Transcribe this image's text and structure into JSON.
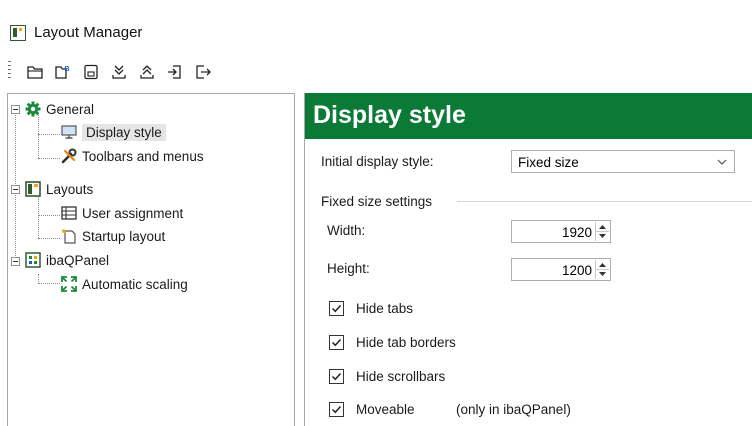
{
  "window": {
    "title": "Layout Manager"
  },
  "toolbar": {
    "buttons": [
      {
        "icon": "folder-open-icon"
      },
      {
        "icon": "folder-blue-icon"
      },
      {
        "icon": "save-icon"
      },
      {
        "icon": "import-icon"
      },
      {
        "icon": "export-icon"
      },
      {
        "icon": "login-icon"
      },
      {
        "icon": "logout-icon"
      }
    ]
  },
  "tree": {
    "general": {
      "label": "General",
      "children": {
        "display_style": "Display style",
        "toolbars": "Toolbars and menus"
      }
    },
    "layouts": {
      "label": "Layouts",
      "children": {
        "user_assignment": "User assignment",
        "startup_layout": "Startup layout"
      }
    },
    "ibaqpanel": {
      "label": "ibaQPanel",
      "children": {
        "automatic_scaling": "Automatic scaling"
      }
    }
  },
  "content": {
    "title": "Display style",
    "initial_display_style": {
      "label": "Initial display style:",
      "value": "Fixed size"
    },
    "group_label": "Fixed size settings",
    "width": {
      "label": "Width:",
      "value": "1920"
    },
    "height": {
      "label": "Height:",
      "value": "1200"
    },
    "checkboxes": {
      "hide_tabs": {
        "label": "Hide tabs",
        "checked": true
      },
      "hide_tab_borders": {
        "label": "Hide tab borders",
        "checked": true
      },
      "hide_scrollbars": {
        "label": "Hide scrollbars",
        "checked": true
      },
      "moveable": {
        "label": "Moveable",
        "note": "(only in ibaQPanel)",
        "checked": true
      }
    }
  },
  "colors": {
    "header_green": "#0a7a36",
    "selection": "#e5e5e5"
  }
}
